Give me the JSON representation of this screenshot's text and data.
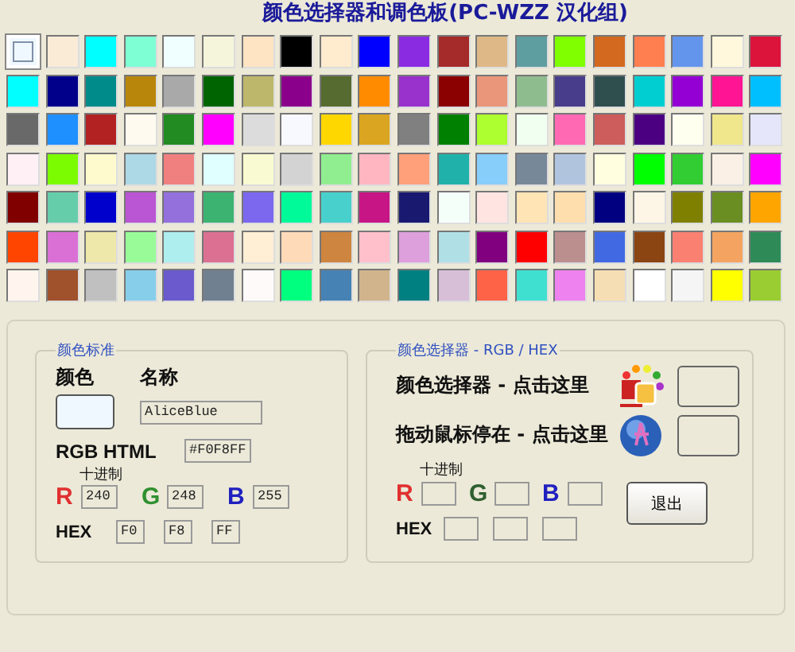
{
  "title": "颜色选择器和调色板(PC-WZZ 汉化组)",
  "palette_rows": [
    {
      "swatches": [
        {
          "color": "#f0f8ff",
          "selected": true
        },
        {
          "color": "#faebd7",
          "selected": false
        },
        {
          "color": "#00ffff",
          "selected": false
        },
        {
          "color": "#7fffd4",
          "selected": false
        },
        {
          "color": "#f0ffff",
          "selected": false
        },
        {
          "color": "#f5f5dc",
          "selected": false
        },
        {
          "color": "#ffe4c4",
          "selected": false
        },
        {
          "color": "#000000",
          "selected": false
        },
        {
          "color": "#ffebcd",
          "selected": false
        },
        {
          "color": "#0000ff",
          "selected": false
        },
        {
          "color": "#8a2be2",
          "selected": false
        },
        {
          "color": "#a52a2a",
          "selected": false
        },
        {
          "color": "#deb887",
          "selected": false
        },
        {
          "color": "#5f9ea0",
          "selected": false
        },
        {
          "color": "#7fff00",
          "selected": false
        },
        {
          "color": "#d2691e",
          "selected": false
        },
        {
          "color": "#ff7f50",
          "selected": false
        },
        {
          "color": "#6495ed",
          "selected": false
        },
        {
          "color": "#fff8dc",
          "selected": false
        },
        {
          "color": "#dc143c",
          "selected": false
        }
      ]
    },
    {
      "swatches": [
        {
          "color": "#00fffe",
          "selected": false
        },
        {
          "color": "#00008b",
          "selected": false
        },
        {
          "color": "#008b8b",
          "selected": false
        },
        {
          "color": "#b8860b",
          "selected": false
        },
        {
          "color": "#a9a9a9",
          "selected": false
        },
        {
          "color": "#006400",
          "selected": false
        },
        {
          "color": "#bdb76b",
          "selected": false
        },
        {
          "color": "#8b008b",
          "selected": false
        },
        {
          "color": "#556b2f",
          "selected": false
        },
        {
          "color": "#ff8c00",
          "selected": false
        },
        {
          "color": "#9932cc",
          "selected": false
        },
        {
          "color": "#8b0000",
          "selected": false
        },
        {
          "color": "#e9967a",
          "selected": false
        },
        {
          "color": "#8fbc8f",
          "selected": false
        },
        {
          "color": "#483d8b",
          "selected": false
        },
        {
          "color": "#2f4f4f",
          "selected": false
        },
        {
          "color": "#00ced1",
          "selected": false
        },
        {
          "color": "#9400d3",
          "selected": false
        },
        {
          "color": "#ff1493",
          "selected": false
        },
        {
          "color": "#00bfff",
          "selected": false
        }
      ]
    },
    {
      "swatches": [
        {
          "color": "#696969",
          "selected": false
        },
        {
          "color": "#1e90ff",
          "selected": false
        },
        {
          "color": "#b22222",
          "selected": false
        },
        {
          "color": "#fffaf0",
          "selected": false
        },
        {
          "color": "#228b22",
          "selected": false
        },
        {
          "color": "#ff00ff",
          "selected": false
        },
        {
          "color": "#dcdcdc",
          "selected": false
        },
        {
          "color": "#f8f8ff",
          "selected": false
        },
        {
          "color": "#ffd700",
          "selected": false
        },
        {
          "color": "#daa520",
          "selected": false
        },
        {
          "color": "#808080",
          "selected": false
        },
        {
          "color": "#008000",
          "selected": false
        },
        {
          "color": "#adff2f",
          "selected": false
        },
        {
          "color": "#f0fff0",
          "selected": false
        },
        {
          "color": "#ff69b4",
          "selected": false
        },
        {
          "color": "#cd5c5c",
          "selected": false
        },
        {
          "color": "#4b0082",
          "selected": false
        },
        {
          "color": "#fffff0",
          "selected": false
        },
        {
          "color": "#f0e68c",
          "selected": false
        },
        {
          "color": "#e6e6fa",
          "selected": false
        }
      ]
    },
    {
      "swatches": [
        {
          "color": "#fff0f5",
          "selected": false
        },
        {
          "color": "#7cfc00",
          "selected": false
        },
        {
          "color": "#fffacd",
          "selected": false
        },
        {
          "color": "#add8e6",
          "selected": false
        },
        {
          "color": "#f08080",
          "selected": false
        },
        {
          "color": "#e0ffff",
          "selected": false
        },
        {
          "color": "#fafad2",
          "selected": false
        },
        {
          "color": "#d3d3d3",
          "selected": false
        },
        {
          "color": "#90ee90",
          "selected": false
        },
        {
          "color": "#ffb6c1",
          "selected": false
        },
        {
          "color": "#ffa07a",
          "selected": false
        },
        {
          "color": "#20b2aa",
          "selected": false
        },
        {
          "color": "#87cefa",
          "selected": false
        },
        {
          "color": "#778899",
          "selected": false
        },
        {
          "color": "#b0c4de",
          "selected": false
        },
        {
          "color": "#ffffe0",
          "selected": false
        },
        {
          "color": "#00ff00",
          "selected": false
        },
        {
          "color": "#32cd32",
          "selected": false
        },
        {
          "color": "#faf0e6",
          "selected": false
        },
        {
          "color": "#ff00fe",
          "selected": false
        }
      ]
    },
    {
      "swatches": [
        {
          "color": "#800000",
          "selected": false
        },
        {
          "color": "#66cdaa",
          "selected": false
        },
        {
          "color": "#0000cd",
          "selected": false
        },
        {
          "color": "#ba55d3",
          "selected": false
        },
        {
          "color": "#9370db",
          "selected": false
        },
        {
          "color": "#3cb371",
          "selected": false
        },
        {
          "color": "#7b68ee",
          "selected": false
        },
        {
          "color": "#00fa9a",
          "selected": false
        },
        {
          "color": "#48d1cc",
          "selected": false
        },
        {
          "color": "#c71585",
          "selected": false
        },
        {
          "color": "#191970",
          "selected": false
        },
        {
          "color": "#f5fffa",
          "selected": false
        },
        {
          "color": "#ffe4e1",
          "selected": false
        },
        {
          "color": "#ffe4b5",
          "selected": false
        },
        {
          "color": "#ffdead",
          "selected": false
        },
        {
          "color": "#000080",
          "selected": false
        },
        {
          "color": "#fdf5e6",
          "selected": false
        },
        {
          "color": "#808000",
          "selected": false
        },
        {
          "color": "#6b8e23",
          "selected": false
        },
        {
          "color": "#ffa500",
          "selected": false
        }
      ]
    },
    {
      "swatches": [
        {
          "color": "#ff4500",
          "selected": false
        },
        {
          "color": "#da70d6",
          "selected": false
        },
        {
          "color": "#eee8aa",
          "selected": false
        },
        {
          "color": "#98fb98",
          "selected": false
        },
        {
          "color": "#afeeee",
          "selected": false
        },
        {
          "color": "#db7093",
          "selected": false
        },
        {
          "color": "#ffefd5",
          "selected": false
        },
        {
          "color": "#ffdab9",
          "selected": false
        },
        {
          "color": "#cd853f",
          "selected": false
        },
        {
          "color": "#ffc0cb",
          "selected": false
        },
        {
          "color": "#dda0dd",
          "selected": false
        },
        {
          "color": "#b0e0e6",
          "selected": false
        },
        {
          "color": "#800080",
          "selected": false
        },
        {
          "color": "#ff0000",
          "selected": false
        },
        {
          "color": "#bc8f8f",
          "selected": false
        },
        {
          "color": "#4169e1",
          "selected": false
        },
        {
          "color": "#8b4513",
          "selected": false
        },
        {
          "color": "#fa8072",
          "selected": false
        },
        {
          "color": "#f4a460",
          "selected": false
        },
        {
          "color": "#2e8b57",
          "selected": false
        }
      ]
    },
    {
      "swatches": [
        {
          "color": "#fff5ee",
          "selected": false
        },
        {
          "color": "#a0522d",
          "selected": false
        },
        {
          "color": "#c0c0c0",
          "selected": false
        },
        {
          "color": "#87ceeb",
          "selected": false
        },
        {
          "color": "#6a5acd",
          "selected": false
        },
        {
          "color": "#708090",
          "selected": false
        },
        {
          "color": "#fffafa",
          "selected": false
        },
        {
          "color": "#00ff7f",
          "selected": false
        },
        {
          "color": "#4682b4",
          "selected": false
        },
        {
          "color": "#d2b48c",
          "selected": false
        },
        {
          "color": "#008080",
          "selected": false
        },
        {
          "color": "#d8bfd8",
          "selected": false
        },
        {
          "color": "#ff6347",
          "selected": false
        },
        {
          "color": "#40e0d0",
          "selected": false
        },
        {
          "color": "#ee82ee",
          "selected": false
        },
        {
          "color": "#f5deb3",
          "selected": false
        },
        {
          "color": "#ffffff",
          "selected": false
        },
        {
          "color": "#f5f5f5",
          "selected": false
        },
        {
          "color": "#ffff00",
          "selected": false
        },
        {
          "color": "#9acd32",
          "selected": false
        }
      ]
    }
  ],
  "standard_group": {
    "title": "颜色标准",
    "color_label": "颜色",
    "name_label": "名称",
    "name_value": "AliceBlue",
    "rgb_html_label": "RGB HTML",
    "rgb_html_value": "#F0F8FF",
    "decimal_label": "十进制",
    "rgb": [
      {
        "label": "R",
        "color": "#e03030",
        "value": "240"
      },
      {
        "label": "G",
        "color": "#309030",
        "value": "248"
      },
      {
        "label": "B",
        "color": "#2020c0",
        "value": "255"
      }
    ],
    "hex_label": "HEX",
    "hex_values": [
      "F0",
      "F8",
      "FF"
    ]
  },
  "picker_group": {
    "title": "颜色选择器 - RGB / HEX",
    "pick_label": "颜色选择器 - 点击这里",
    "hover_label": "拖动鼠标停在 - 点击这里",
    "decimal_label": "十进制",
    "rgb": [
      {
        "label": "R",
        "color": "#e03030"
      },
      {
        "label": "G",
        "color": "#306030"
      },
      {
        "label": "B",
        "color": "#2020c0"
      }
    ],
    "hex_label": "HEX",
    "exit_button": "退出"
  }
}
